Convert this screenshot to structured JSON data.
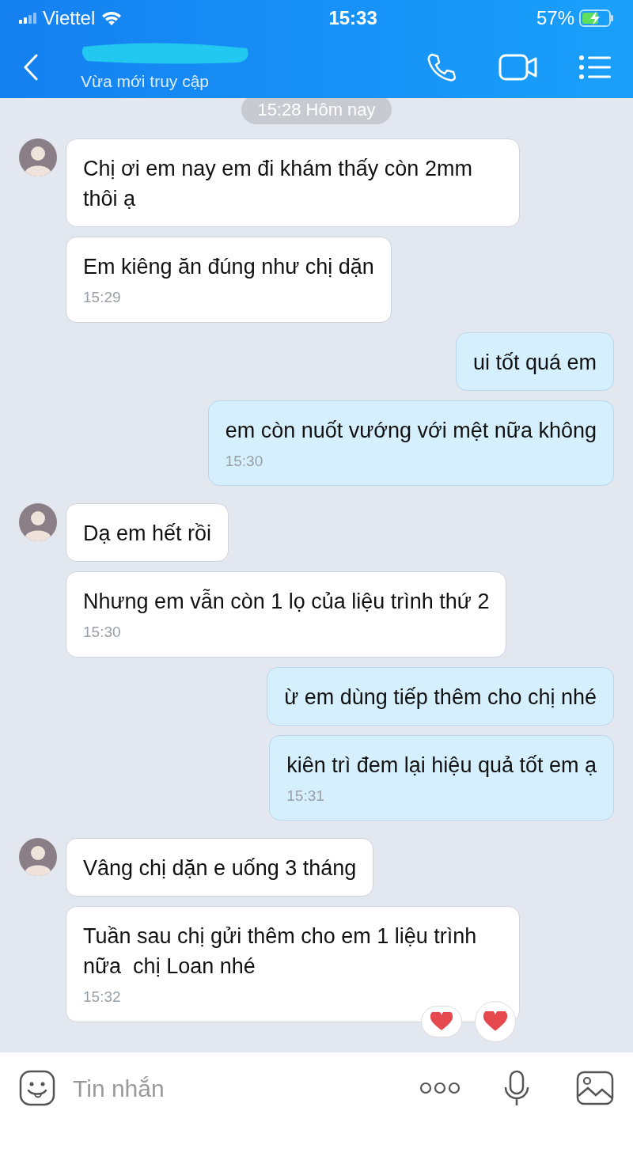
{
  "status_bar": {
    "carrier": "Viettel",
    "time": "15:33",
    "battery": "57%"
  },
  "header": {
    "subtitle": "Vừa mới truy cập"
  },
  "date_divider": "15:28 Hôm nay",
  "messages": [
    {
      "kind": "in",
      "avatar": true,
      "text": "Chị ơi em nay em đi khám thấy còn 2mm thôi ạ",
      "reacted": false
    },
    {
      "kind": "in",
      "avatar": false,
      "text": "Em kiêng ăn đúng như chị dặn",
      "time": "15:29",
      "reacted": false
    },
    {
      "kind": "out",
      "text": "ui tốt quá em",
      "reacted": false
    },
    {
      "kind": "out",
      "text": "em còn nuốt vướng với mệt nữa không",
      "time": "15:30",
      "reacted": false
    },
    {
      "kind": "in",
      "avatar": true,
      "text": "Dạ em hết rồi",
      "reacted": false
    },
    {
      "kind": "in",
      "avatar": false,
      "text": "Nhưng em vẫn còn 1 lọ của liệu trình thứ 2",
      "time": "15:30",
      "reacted": false
    },
    {
      "kind": "out",
      "text": "ừ em dùng tiếp thêm cho chị nhé",
      "reacted": false
    },
    {
      "kind": "out",
      "text": "kiên trì đem lại hiệu quả tốt em ạ",
      "time": "15:31",
      "reacted": false
    },
    {
      "kind": "in",
      "avatar": true,
      "text": "Vâng chị dặn e uống 3 tháng",
      "reacted": false
    },
    {
      "kind": "in",
      "avatar": false,
      "text": "Tuần sau chị gửi thêm cho em 1 liệu trình nữa  chị Loan nhé",
      "time": "15:32",
      "reacted": true
    }
  ],
  "composer": {
    "placeholder": "Tin nhắn"
  }
}
